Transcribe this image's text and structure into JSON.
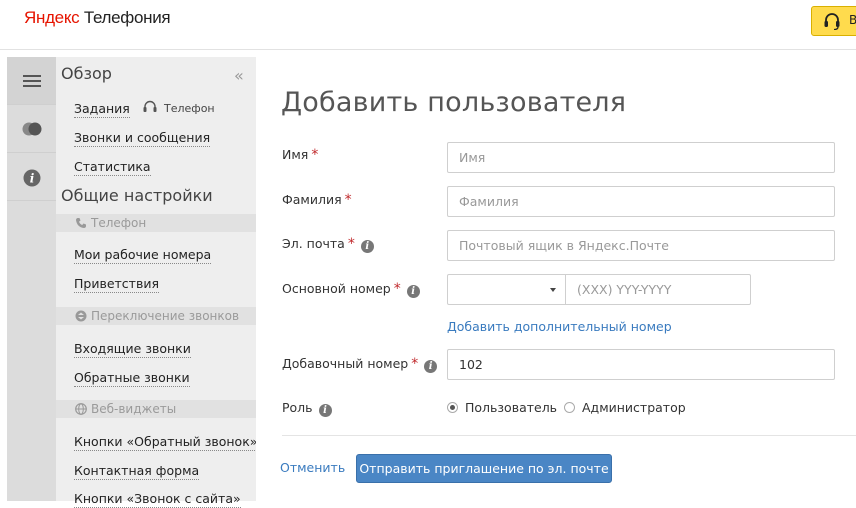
{
  "header": {
    "logo_brand": "Яндекс",
    "logo_product": "Телефония",
    "support_label": "В"
  },
  "sidebar": {
    "overview_title": "Обзор",
    "collapse_icon": "«",
    "overview_links": [
      {
        "label": "Задания"
      },
      {
        "label": "Звонки и сообщения"
      },
      {
        "label": "Статистика"
      }
    ],
    "phone_status": "Телефон",
    "general_title": "Общие настройки",
    "sections": [
      {
        "title": "Телефон",
        "icon": "phone-icon",
        "items": [
          {
            "label": "Мои рабочие номера"
          },
          {
            "label": "Приветствия"
          }
        ]
      },
      {
        "title": "Переключение звонков",
        "icon": "switch-icon",
        "items": [
          {
            "label": "Входящие звонки"
          },
          {
            "label": "Обратные звонки"
          }
        ]
      },
      {
        "title": "Веб-виджеты",
        "icon": "globe-icon",
        "items": [
          {
            "label": "Кнопки «Обратный звонок»"
          },
          {
            "label": "Контактная форма"
          },
          {
            "label": "Кнопки «Звонок с сайта»"
          }
        ]
      }
    ]
  },
  "rail": {
    "icons": [
      "menu-icon",
      "toggle-icon",
      "info-icon"
    ]
  },
  "form": {
    "title": "Добавить пользователя",
    "first_name": {
      "label": "Имя",
      "placeholder": "Имя",
      "value": ""
    },
    "last_name": {
      "label": "Фамилия",
      "placeholder": "Фамилия",
      "value": ""
    },
    "email": {
      "label": "Эл. почта",
      "placeholder": "Почтовый ящик в Яндекс.Почте",
      "value": ""
    },
    "main_number": {
      "label": "Основной номер",
      "select_value": "",
      "placeholder": "(XXX) YYY-YYYY",
      "value": ""
    },
    "add_number_link": "Добавить дополнительный номер",
    "extension": {
      "label": "Добавочный номер",
      "value": "102"
    },
    "role": {
      "label": "Роль",
      "options": [
        {
          "label": "Пользователь",
          "selected": true
        },
        {
          "label": "Администратор",
          "selected": false
        }
      ]
    },
    "cancel_label": "Отменить",
    "submit_label": "Отправить приглашение по эл. почте"
  },
  "colors": {
    "brand_red": "#e61400",
    "support_yellow": "#ffdb4d",
    "link_blue": "#3a7bbf",
    "button_blue": "#4a86c5",
    "required_red": "#c0282b"
  }
}
